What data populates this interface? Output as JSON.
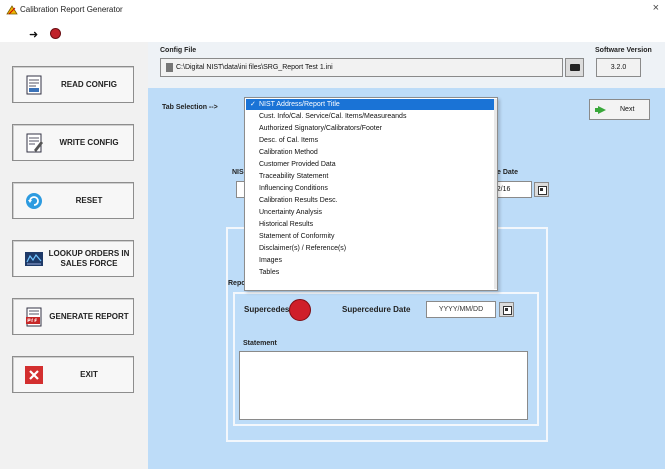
{
  "window": {
    "title": "Calibration Report Generator"
  },
  "toolbar": {
    "run": "run-arrow",
    "stop": "stop-button"
  },
  "config": {
    "label": "Config File",
    "path": "C:\\Digital NIST\\data\\ini files\\SRG_Report Test 1.ini",
    "software_label": "Software Version",
    "software_version": "3.2.0"
  },
  "sidebar": {
    "items": [
      {
        "label": "READ CONFIG"
      },
      {
        "label": "WRITE CONFIG"
      },
      {
        "label": "RESET"
      },
      {
        "label": "LOOKUP ORDERS IN SALES FORCE"
      },
      {
        "label": "GENERATE REPORT"
      },
      {
        "label": "EXIT"
      }
    ]
  },
  "tab_selection": {
    "label": "Tab Selection -->",
    "next_label": "Next",
    "options": [
      "NIST Address/Report Title",
      "Cust. Info/Cal. Service/Cal. Items/Measureands",
      "Authorized Signatory/Calibrators/Footer",
      "Desc. of Cal. Items",
      "Calibration Method",
      "Customer Provided Data",
      "Traceability Statement",
      "Influencing Conditions",
      "Calibration Results Desc.",
      "Uncertainty Analysis",
      "Historical Results",
      "Statement of Conformity",
      "Disclaimer(s) / Reference(s)",
      "Images",
      "Tables"
    ],
    "selected": "NIST Address/Report Title"
  },
  "behind_fields": {
    "nist_partial": "NIS",
    "date_label_partial": "e Date",
    "date_value_partial": "6/02/16",
    "report_partial": "Repo"
  },
  "supersede": {
    "label": "Supercedes?",
    "date_label": "Supercedure Date",
    "date_placeholder": "YYYY/MM/DD",
    "statement_label": "Statement"
  },
  "colors": {
    "panel_blue": "#bddcf8",
    "selection_blue": "#1a73d6",
    "led_red": "#cf1f2a",
    "next_green": "#39a83a"
  }
}
